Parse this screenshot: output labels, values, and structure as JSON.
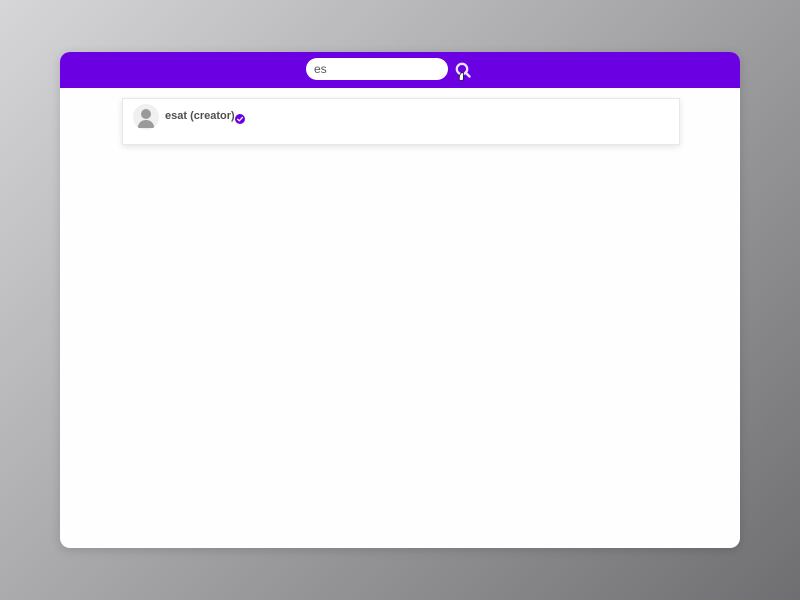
{
  "search": {
    "value": "es",
    "button_icon": "search-icon"
  },
  "results": [
    {
      "name": "esat (creator)",
      "avatar_icon": "user-avatar-icon",
      "badge_icon": "verified-badge-icon"
    }
  ],
  "colors": {
    "accent": "#6b00e3",
    "text": "#505050",
    "card_border": "#e8e8ea"
  }
}
